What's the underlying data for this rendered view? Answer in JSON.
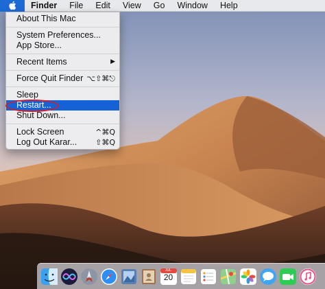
{
  "menubar": {
    "apple_icon": "apple-logo-icon",
    "items": [
      "Finder",
      "File",
      "Edit",
      "View",
      "Go",
      "Window",
      "Help"
    ]
  },
  "apple_menu": {
    "about": "About This Mac",
    "system_preferences": "System Preferences...",
    "app_store": "App Store...",
    "recent_items": "Recent Items",
    "recent_items_arrow": "▶",
    "force_quit": "Force Quit Finder",
    "force_quit_shortcut": "⌥⇧⌘⎋",
    "sleep": "Sleep",
    "restart": "Restart...",
    "shut_down": "Shut Down...",
    "lock_screen": "Lock Screen",
    "lock_screen_shortcut": "^⌘Q",
    "log_out": "Log Out Karar...",
    "log_out_shortcut": "⇧⌘Q"
  },
  "dock": {
    "calendar_month": "JUL",
    "calendar_day": "20",
    "icons": [
      "finder-icon",
      "siri-icon",
      "launchpad-icon",
      "safari-icon",
      "photo-booth-icon",
      "contacts-icon",
      "calendar-icon",
      "notes-icon",
      "reminders-icon",
      "maps-icon",
      "photos-icon",
      "messages-icon",
      "facetime-icon",
      "itunes-icon"
    ]
  },
  "colors": {
    "selection": "#1561d6",
    "highlight_ring": "#d21f2a",
    "apple_button": "#1d6ad7"
  }
}
